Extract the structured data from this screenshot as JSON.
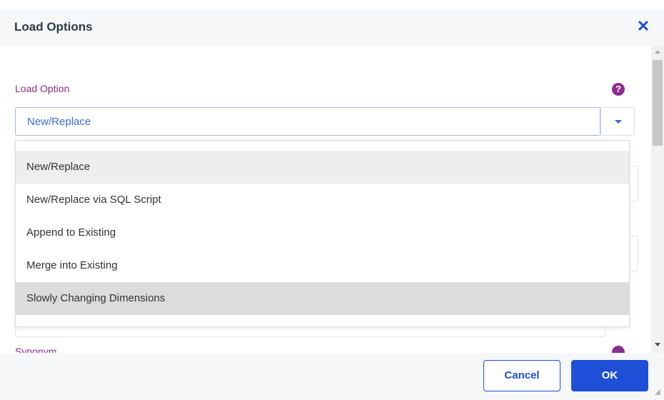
{
  "dialog": {
    "title": "Load Options",
    "close_glyph": "✕"
  },
  "fields": {
    "load_option": {
      "label": "Load Option",
      "help_glyph": "?",
      "selected_value": "New/Replace"
    },
    "next_label_partial": "Synonym"
  },
  "dropdown": {
    "options": [
      "New/Replace",
      "New/Replace via SQL Script",
      "Append to Existing",
      "Merge into Existing",
      "Slowly Changing Dimensions"
    ]
  },
  "footer": {
    "cancel_label": "Cancel",
    "ok_label": "OK"
  },
  "colors": {
    "accent": "#1f4fd6",
    "label_purple": "#8a2d8f",
    "selected_text": "#3b6bdc"
  },
  "icons": [
    "close-icon",
    "help-icon",
    "chevron-down-icon",
    "resize-grip-icon"
  ]
}
